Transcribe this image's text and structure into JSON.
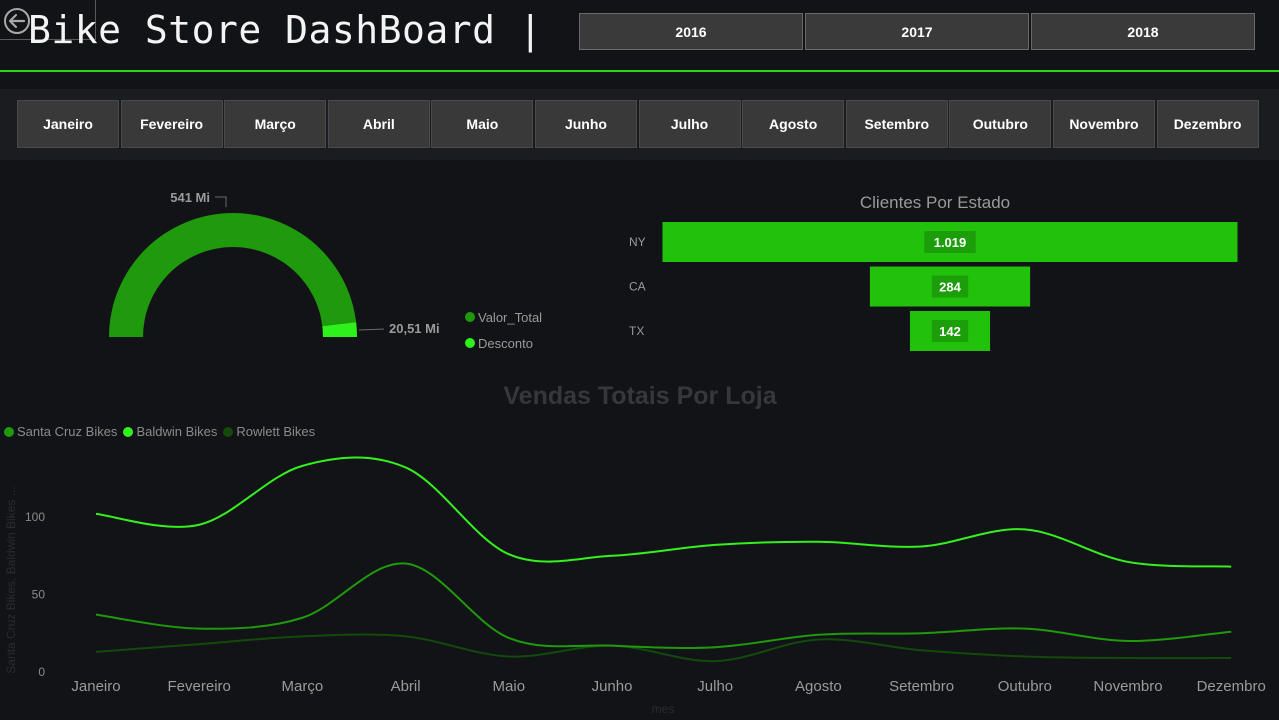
{
  "header": {
    "title": "Bike Store DashBoard |",
    "years": [
      "2016",
      "2017",
      "2018"
    ]
  },
  "months": [
    "Janeiro",
    "Fevereiro",
    "Março",
    "Abril",
    "Maio",
    "Junho",
    "Julho",
    "Agosto",
    "Setembro",
    "Outubro",
    "Novembro",
    "Dezembro"
  ],
  "gauge": {
    "total_label": "541 Mi",
    "discount_label": "20,51 Mi",
    "total_value_mi": 541,
    "discount_value_mi": 20.51,
    "legend": [
      {
        "name": "Valor_Total",
        "color": "#1f9a0c"
      },
      {
        "name": "Desconto",
        "color": "#2ef01a"
      }
    ]
  },
  "funnel": {
    "title": "Clientes Por Estado",
    "bar_color": "#22c20c",
    "label_bg": "#1c9d0a",
    "items": [
      {
        "state": "NY",
        "value": 1019,
        "label": "1.019"
      },
      {
        "state": "CA",
        "value": 284,
        "label": "284"
      },
      {
        "state": "TX",
        "value": 142,
        "label": "142"
      }
    ]
  },
  "chart_data": {
    "type": "line",
    "title": "Vendas Totais Por Loja",
    "xlabel": "mes",
    "ylabel": "Santa Cruz Bikes, Baldwin Bikes ...",
    "categories": [
      "Janeiro",
      "Fevereiro",
      "Março",
      "Abril",
      "Maio",
      "Junho",
      "Julho",
      "Agosto",
      "Setembro",
      "Outubro",
      "Novembro",
      "Dezembro"
    ],
    "yticks": [
      0,
      50,
      100
    ],
    "ylim": [
      0,
      140
    ],
    "series": [
      {
        "name": "Santa Cruz Bikes",
        "color": "#1f9a0c",
        "values": [
          37,
          28,
          35,
          70,
          22,
          17,
          16,
          24,
          25,
          28,
          20,
          26
        ]
      },
      {
        "name": "Baldwin Bikes",
        "color": "#35f01f",
        "values": [
          102,
          95,
          133,
          132,
          76,
          75,
          82,
          84,
          81,
          92,
          71,
          68
        ]
      },
      {
        "name": "Rowlett Bikes",
        "color": "#124a0c",
        "values": [
          13,
          18,
          23,
          23,
          10,
          17,
          7,
          21,
          14,
          10,
          9,
          9
        ]
      }
    ]
  }
}
